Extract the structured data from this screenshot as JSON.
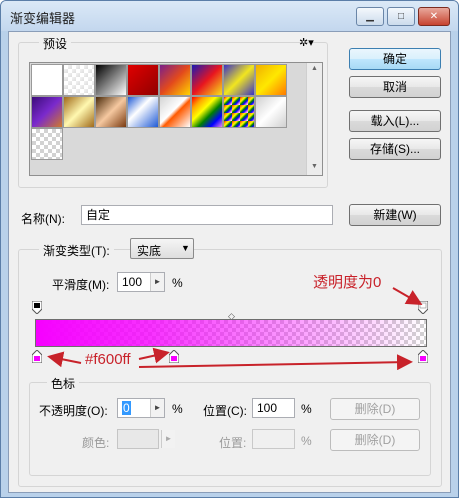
{
  "window": {
    "title": "渐变编辑器",
    "minimize_glyph": "▁",
    "maximize_glyph": "□",
    "close_glyph": "✕"
  },
  "presets": {
    "label": "预设",
    "gear_glyph": "✲▾",
    "scroll_up_glyph": "▲",
    "scroll_down_glyph": "▼"
  },
  "buttons": {
    "ok": "确定",
    "cancel": "取消",
    "load": "载入(L)...",
    "save": "存储(S)...",
    "new": "新建(W)",
    "delete": "删除(D)"
  },
  "name_row": {
    "label": "名称(N):",
    "value": "自定"
  },
  "gradient": {
    "type_label": "渐变类型(T):",
    "type_value": "实底",
    "smoothness_label": "平滑度(M):",
    "smoothness_value": "100",
    "smoothness_unit": "%",
    "color": "#f600ff"
  },
  "color_stops": {
    "label": "色标",
    "opacity_label": "不透明度(O):",
    "opacity_value": "0",
    "location_label": "位置(C):",
    "location_value": "100",
    "color_label": "颜色:",
    "color_location_label": "位置:",
    "unit": "%"
  },
  "annotations": {
    "transparency": "透明度为0",
    "color_hex": "#f600ff",
    "annotation_color": "#c8222a"
  }
}
